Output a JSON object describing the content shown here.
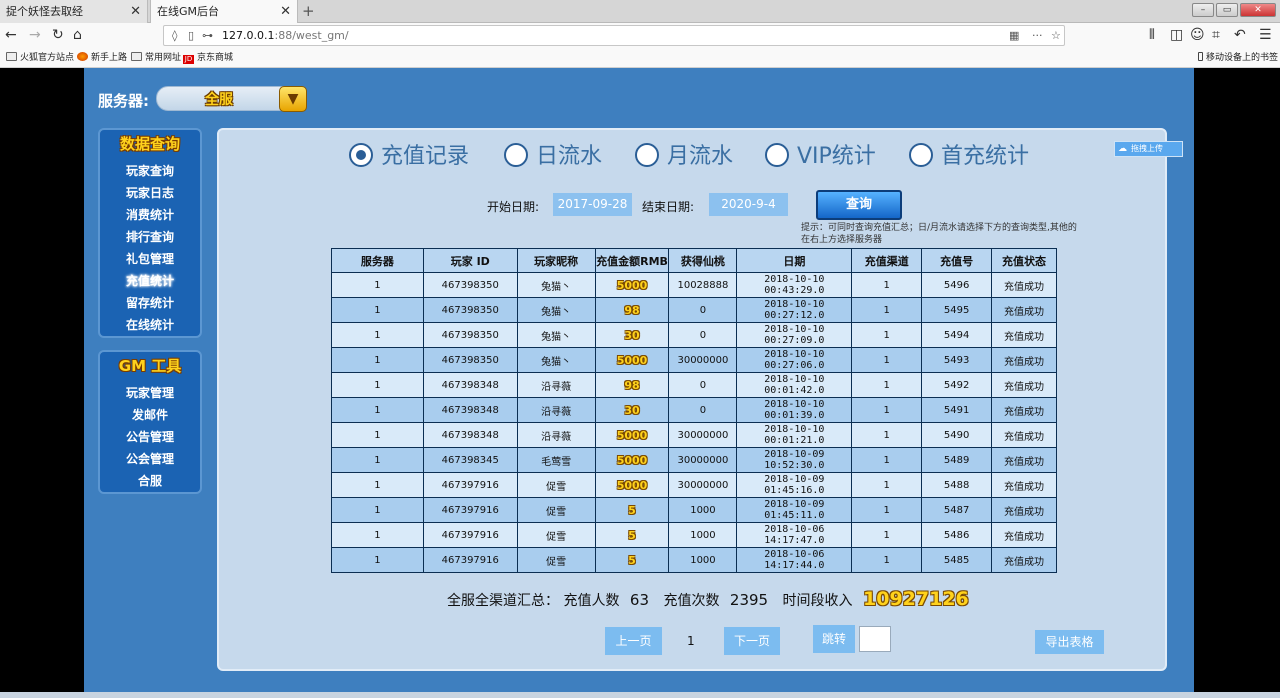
{
  "browser": {
    "tabs": [
      {
        "label": "捉个妖怪去取经"
      },
      {
        "label": "在线GM后台"
      }
    ],
    "url_host": "127.0.0.1",
    "url_path": ":88/west_gm/",
    "bookmarks": [
      {
        "label": "火狐官方站点",
        "icon": "folder"
      },
      {
        "label": "新手上路",
        "icon": "firefox"
      },
      {
        "label": "常用网址",
        "icon": "folder"
      },
      {
        "label": "京东商城",
        "icon": "jd"
      }
    ],
    "mobile_bookmarks": "移动设备上的书签"
  },
  "server": {
    "label": "服务器:",
    "value": "全服"
  },
  "sidebar": {
    "query_title": "数据查询",
    "query_items": [
      "玩家查询",
      "玩家日志",
      "消费统计",
      "排行查询",
      "礼包管理",
      "充值统计",
      "留存统计",
      "在线统计"
    ],
    "active_item": "充值统计",
    "gm_title": "GM 工具",
    "gm_items": [
      "玩家管理",
      "发邮件",
      "公告管理",
      "公会管理",
      "合服"
    ]
  },
  "radios": [
    {
      "label": "充值记录",
      "checked": true
    },
    {
      "label": "日流水",
      "checked": false
    },
    {
      "label": "月流水",
      "checked": false
    },
    {
      "label": "VIP统计",
      "checked": false
    },
    {
      "label": "首充统计",
      "checked": false
    }
  ],
  "dates": {
    "start_label": "开始日期:",
    "start_value": "2017-09-28",
    "end_label": "结束日期:",
    "end_value": "2020-9-4",
    "query_button": "查询"
  },
  "hint": "提示：可同时查询充值汇总；日/月流水请选择下方的查询类型,其他的在右上方选择服务器",
  "table": {
    "columns": [
      "服务器",
      "玩家 ID",
      "玩家昵称",
      "充值金额RMB",
      "获得仙桃",
      "日期",
      "充值渠道",
      "充值号",
      "充值状态"
    ],
    "rows": [
      [
        "1",
        "467398350",
        "兔猫丶",
        "5000",
        "10028888",
        "2018-10-10 00:43:29.0",
        "1",
        "5496",
        "充值成功"
      ],
      [
        "1",
        "467398350",
        "兔猫丶",
        "98",
        "0",
        "2018-10-10 00:27:12.0",
        "1",
        "5495",
        "充值成功"
      ],
      [
        "1",
        "467398350",
        "兔猫丶",
        "30",
        "0",
        "2018-10-10 00:27:09.0",
        "1",
        "5494",
        "充值成功"
      ],
      [
        "1",
        "467398350",
        "兔猫丶",
        "5000",
        "30000000",
        "2018-10-10 00:27:06.0",
        "1",
        "5493",
        "充值成功"
      ],
      [
        "1",
        "467398348",
        "沿寻薇",
        "98",
        "0",
        "2018-10-10 00:01:42.0",
        "1",
        "5492",
        "充值成功"
      ],
      [
        "1",
        "467398348",
        "沿寻薇",
        "30",
        "0",
        "2018-10-10 00:01:39.0",
        "1",
        "5491",
        "充值成功"
      ],
      [
        "1",
        "467398348",
        "沿寻薇",
        "5000",
        "30000000",
        "2018-10-10 00:01:21.0",
        "1",
        "5490",
        "充值成功"
      ],
      [
        "1",
        "467398345",
        "毛莺雪",
        "5000",
        "30000000",
        "2018-10-09 10:52:30.0",
        "1",
        "5489",
        "充值成功"
      ],
      [
        "1",
        "467397916",
        "促雪",
        "5000",
        "30000000",
        "2018-10-09 01:45:16.0",
        "1",
        "5488",
        "充值成功"
      ],
      [
        "1",
        "467397916",
        "促雪",
        "5",
        "1000",
        "2018-10-09 01:45:11.0",
        "1",
        "5487",
        "充值成功"
      ],
      [
        "1",
        "467397916",
        "促雪",
        "5",
        "1000",
        "2018-10-06 14:17:47.0",
        "1",
        "5486",
        "充值成功"
      ],
      [
        "1",
        "467397916",
        "促雪",
        "5",
        "1000",
        "2018-10-06 14:17:44.0",
        "1",
        "5485",
        "充值成功"
      ]
    ]
  },
  "summary": {
    "prefix": "全服全渠道汇总：",
    "users_label": "充值人数",
    "users": "63",
    "count_label": "充值次数",
    "count": "2395",
    "income_label": "时间段收入",
    "income": "10927126"
  },
  "pagination": {
    "prev": "上一页",
    "current": "1",
    "next": "下一页",
    "jump": "跳转",
    "export": "导出表格"
  },
  "upload_button": "拖拽上传"
}
